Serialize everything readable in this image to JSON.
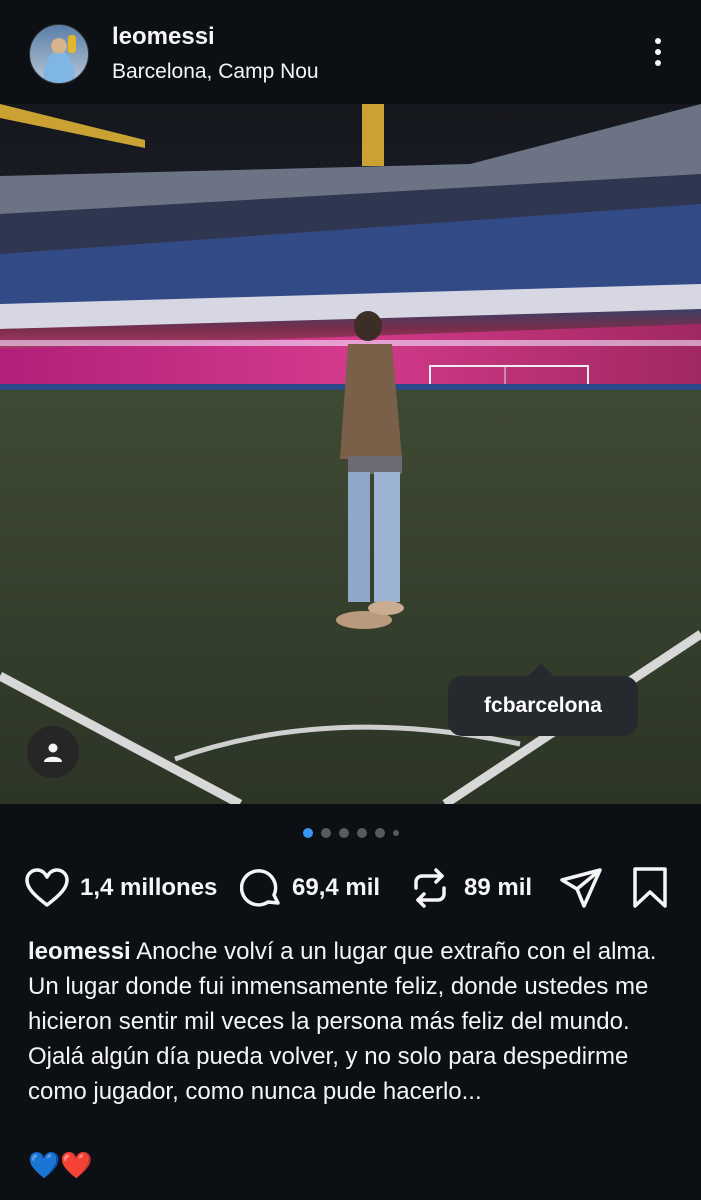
{
  "header": {
    "username": "leomessi",
    "location": "Barcelona, Camp Nou",
    "more_icon": "more-vertical-icon"
  },
  "photo": {
    "tag_label": "fcbarcelona",
    "person_icon": "person-icon"
  },
  "carousel": {
    "count": 6,
    "active_index": 0
  },
  "actions": {
    "likes": "1,4 millones",
    "comments": "69,4 mil",
    "reposts": "89 mil",
    "icons": [
      "heart-icon",
      "comment-icon",
      "repost-icon",
      "share-icon",
      "bookmark-icon"
    ]
  },
  "caption": {
    "username": "leomessi",
    "text": "Anoche volví a un lugar que extraño con el alma. Un lugar donde fui inmensamente feliz, donde ustedes me hicieron sentir mil veces la persona más feliz del mundo. Ojalá algún día pueda volver, y no solo para despedirme como jugador, como nunca pude hacerlo...",
    "emojis": "💙❤️"
  },
  "colors": {
    "background": "#0c1014",
    "text": "#f5f5f5",
    "accent_dot": "#3897f0",
    "tag_bg": "#262a2e"
  }
}
